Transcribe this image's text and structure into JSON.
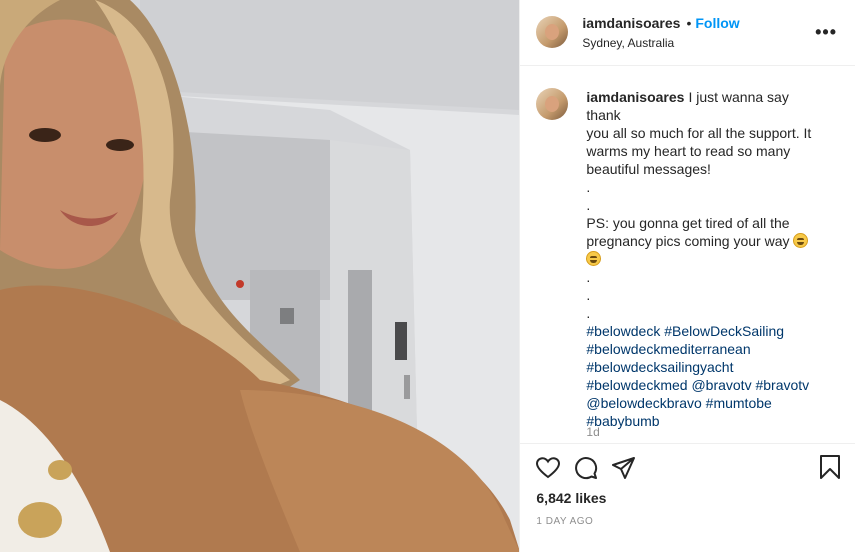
{
  "post": {
    "username": "iamdanisoares",
    "follow_label": "Follow",
    "separator": "•",
    "location": "Sydney, Australia",
    "more_label": "•••"
  },
  "caption": {
    "username": "iamdanisoares",
    "lines": [
      "I just wanna say thank",
      "you all so much for all the support. It",
      "warms my heart to read so many",
      "beautiful messages!",
      ".",
      ".",
      "PS: you gonna get tired of all the",
      "pregnancy pics coming your way",
      "",
      ".",
      ".",
      "."
    ],
    "hashtag_lines": [
      "#belowdeck #BelowDeckSailing",
      "#belowdeckmediterranean",
      "#belowdecksailingyacht",
      "#belowdeckmed @bravotv #bravotv",
      "@belowdeckbravo #mumtobe",
      "#babybumb"
    ],
    "age": "1d"
  },
  "actions": {
    "like_icon": "heart-icon",
    "comment_icon": "comment-icon",
    "share_icon": "share-icon",
    "save_icon": "bookmark-icon"
  },
  "likes": "6,842 likes",
  "date": "1 DAY AGO",
  "colors": {
    "link_blue": "#0095f6",
    "hashtag": "#00376b",
    "muted": "#8e8e8e",
    "photo_top": "#c6c8cc",
    "top_color": "#b07a4f"
  }
}
